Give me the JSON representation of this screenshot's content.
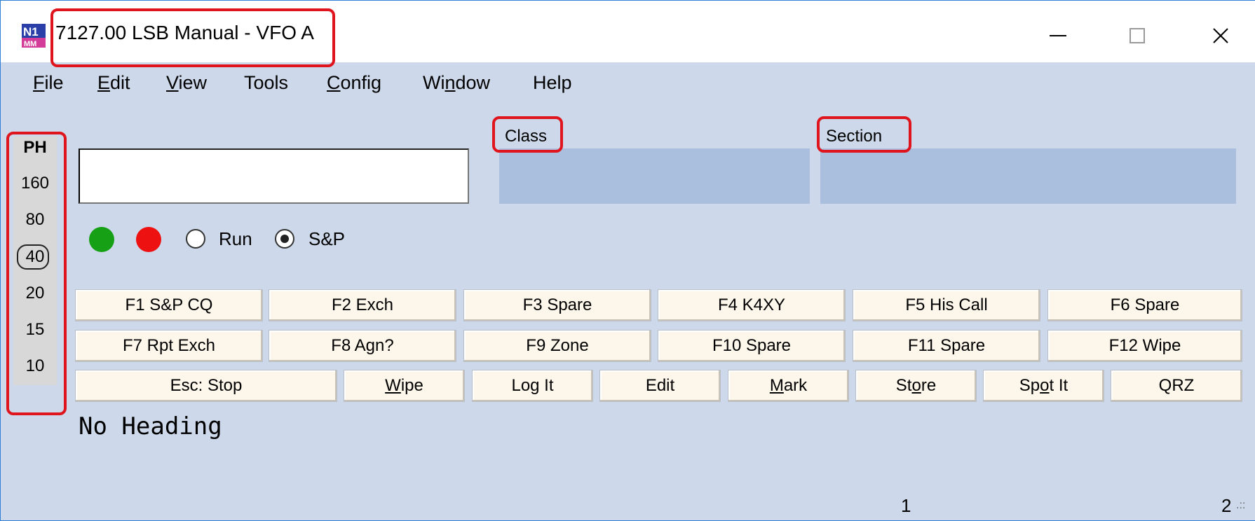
{
  "window": {
    "title": "7127.00 LSB Manual - VFO A",
    "icon": "n1mm-logo-icon",
    "controls": [
      "minimize-icon",
      "maximize-icon",
      "close-icon"
    ]
  },
  "menu": {
    "file": {
      "pre": "",
      "key": "F",
      "post": "ile"
    },
    "edit": {
      "pre": "",
      "key": "E",
      "post": "dit"
    },
    "view": {
      "pre": "",
      "key": "V",
      "post": "iew"
    },
    "tools": {
      "pre": "Tools",
      "key": "",
      "post": ""
    },
    "config": {
      "pre": "",
      "key": "C",
      "post": "onfig"
    },
    "window": {
      "pre": "Wi",
      "key": "n",
      "post": "dow"
    },
    "help": {
      "pre": "Help",
      "key": "",
      "post": ""
    }
  },
  "fields": {
    "call": {
      "value": ""
    },
    "class_label": "Class",
    "section_label": "Section"
  },
  "indicators": {
    "green": "#16a016",
    "red": "#ee1111"
  },
  "mode": {
    "run_label": "Run",
    "sp_label": "S&P",
    "selected": "S&P"
  },
  "bands": {
    "mode_header": "PH",
    "list": [
      "160",
      "80",
      "40",
      "20",
      "15",
      "10"
    ],
    "selected": "40"
  },
  "function_keys": {
    "row1": [
      "F1 S&P CQ",
      "F2 Exch",
      "F3 Spare",
      "F4 K4XY",
      "F5 His Call",
      "F6 Spare"
    ],
    "row2": [
      "F7 Rpt Exch",
      "F8 Agn?",
      "F9 Zone",
      "F10 Spare",
      "F11 Spare",
      "F12 Wipe"
    ]
  },
  "action_keys": {
    "esc_stop": {
      "pre": "Esc: Stop",
      "key": "",
      "post": ""
    },
    "wipe": {
      "pre": "",
      "key": "W",
      "post": "ipe"
    },
    "log_it": {
      "pre": "Log It",
      "key": "",
      "post": ""
    },
    "edit": {
      "pre": "Edit",
      "key": "",
      "post": ""
    },
    "mark": {
      "pre": "",
      "key": "M",
      "post": "ark"
    },
    "store": {
      "pre": "St",
      "key": "o",
      "post": "re"
    },
    "spot_it": {
      "pre": "Sp",
      "key": "o",
      "post": "t It"
    },
    "qrz": {
      "pre": "QRZ",
      "key": "",
      "post": ""
    }
  },
  "heading": "No Heading",
  "status_bar": {
    "cell1": "1",
    "cell2": "2"
  },
  "colors": {
    "highlight": "#e0141c",
    "window_bg": "#cdd9ea",
    "field_bg": "#a9bfdd"
  }
}
